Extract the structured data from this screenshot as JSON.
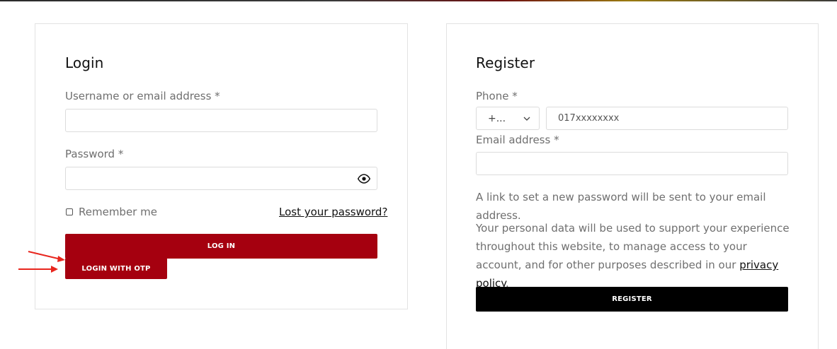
{
  "login": {
    "title": "Login",
    "username_label": "Username or email address *",
    "password_label": "Password *",
    "remember_label": "Remember me",
    "lost_password": "Lost your password?",
    "login_button": "LOG IN",
    "otp_button": "LOGIN WITH OTP"
  },
  "register": {
    "title": "Register",
    "phone_label": "Phone *",
    "country_code": "+...",
    "phone_value": "017xxxxxxxx",
    "email_label": "Email address *",
    "password_note": "A link to set a new password will be sent to your email address.",
    "privacy_text": "Your personal data will be used to support your experience throughout this website, to manage access to your account, and for other purposes described in our",
    "privacy_link": "privacy policy",
    "privacy_end": ".",
    "register_button": "REGISTER"
  },
  "colors": {
    "primary_red": "#a5000f",
    "register_black": "#000000",
    "annotation_arrow": "#e8261e"
  },
  "icons": [
    "eye-icon",
    "chevron-down-icon",
    "annotation-arrow"
  ]
}
